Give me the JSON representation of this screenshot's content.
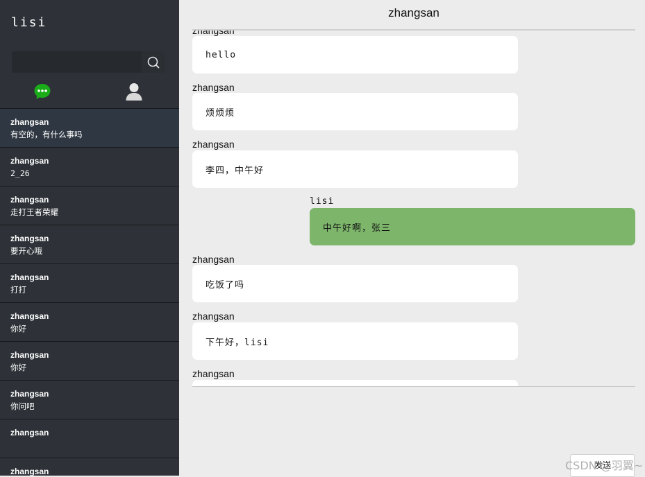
{
  "user": {
    "name": "lisi"
  },
  "search": {
    "placeholder": ""
  },
  "sessions": [
    {
      "name": "zhangsan",
      "last": "有空的，有什么事吗"
    },
    {
      "name": "zhangsan",
      "last": "2_26"
    },
    {
      "name": "zhangsan",
      "last": "走打王者荣耀"
    },
    {
      "name": "zhangsan",
      "last": "要开心哦"
    },
    {
      "name": "zhangsan",
      "last": "打打"
    },
    {
      "name": "zhangsan",
      "last": "你好"
    },
    {
      "name": "zhangsan",
      "last": "你好"
    },
    {
      "name": "zhangsan",
      "last": "你问吧"
    },
    {
      "name": "zhangsan",
      "last": ""
    },
    {
      "name": "zhangsan",
      "last": ""
    }
  ],
  "chat": {
    "title": "zhangsan",
    "messages": [
      {
        "sender": "zhangsan",
        "text": "hello",
        "mine": false
      },
      {
        "sender": "zhangsan",
        "text": "烦烦烦",
        "mine": false
      },
      {
        "sender": "zhangsan",
        "text": "李四，中午好",
        "mine": false
      },
      {
        "sender": "lisi",
        "text": "中午好啊，张三",
        "mine": true
      },
      {
        "sender": "zhangsan",
        "text": "吃饭了吗",
        "mine": false
      },
      {
        "sender": "zhangsan",
        "text": "下午好，lisi",
        "mine": false
      },
      {
        "sender": "zhangsan",
        "text": "",
        "mine": false
      }
    ]
  },
  "send_label": "发送",
  "watermark": "CSDN @羽翼~",
  "colors": {
    "sidebar": "#2e3238",
    "active_session": "#2f3742",
    "my_bubble": "#7db56b",
    "chat_bg": "#ececec",
    "chat_icon": "#1aad19"
  },
  "icons": {
    "search": "search-icon",
    "chat": "chat-bubble-icon",
    "contacts": "person-icon"
  }
}
